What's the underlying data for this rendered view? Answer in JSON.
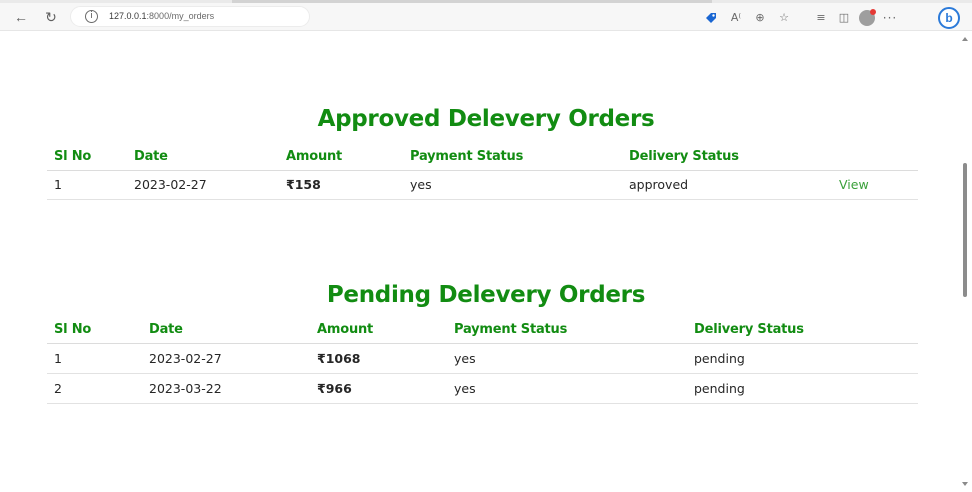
{
  "browser": {
    "url_host": "127.0.0.1",
    "url_path": ":8000/my_orders",
    "info_glyph": "i",
    "icons": [
      "back-arrow-icon",
      "reload-icon",
      "site-info-icon",
      "tag-icon",
      "read-aloud-icon",
      "zoom-icon",
      "favorite-icon",
      "favorites-icon",
      "collections-icon",
      "profile-icon",
      "more-icon",
      "bing-icon"
    ],
    "more_label": "···",
    "bing_label": "b"
  },
  "approved": {
    "title": "Approved Delevery Orders",
    "headers": [
      "Sl No",
      "Date",
      "Amount",
      "Payment Status",
      "Delivery Status",
      ""
    ],
    "rows": [
      {
        "sl": "1",
        "date": "2023-02-27",
        "amount": "₹158",
        "payment": "yes",
        "delivery": "approved",
        "action": "View"
      }
    ]
  },
  "pending": {
    "title": "Pending Delevery Orders",
    "headers": [
      "Sl No",
      "Date",
      "Amount",
      "Payment Status",
      "Delivery Status"
    ],
    "rows": [
      {
        "sl": "1",
        "date": "2023-02-27",
        "amount": "₹1068",
        "payment": "yes",
        "delivery": "pending"
      },
      {
        "sl": "2",
        "date": "2023-03-22",
        "amount": "₹966",
        "payment": "yes",
        "delivery": "pending"
      }
    ]
  },
  "colors": {
    "accent_green": "#128c12",
    "link_green": "#3aa03a"
  }
}
